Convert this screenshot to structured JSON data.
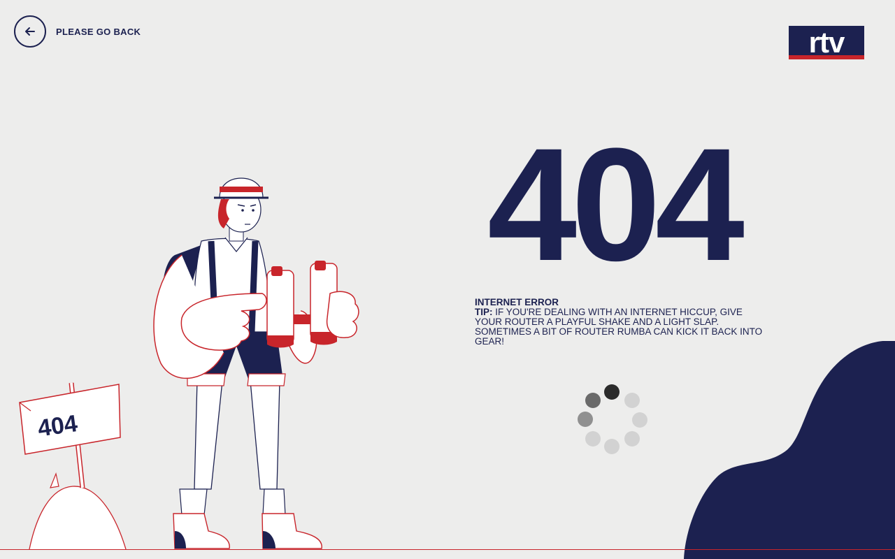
{
  "nav": {
    "back_label": "PLEASE GO BACK",
    "back_icon": "arrow-left-icon"
  },
  "logo": {
    "text": "rtv"
  },
  "error": {
    "code": "404",
    "title": "INTERNET ERROR",
    "tip_label": "TIP:",
    "tip_text": " IF YOU'RE DEALING WITH AN INTERNET HICCUP, GIVE YOUR ROUTER A PLAYFUL SHAKE AND A LIGHT SLAP. SOMETIMES A BIT OF ROUTER RUMBA CAN KICK IT BACK INTO GEAR!"
  },
  "illustration": {
    "sign_text": "404"
  },
  "colors": {
    "navy": "#1c2150",
    "red": "#c8252b",
    "background": "#ededec"
  }
}
